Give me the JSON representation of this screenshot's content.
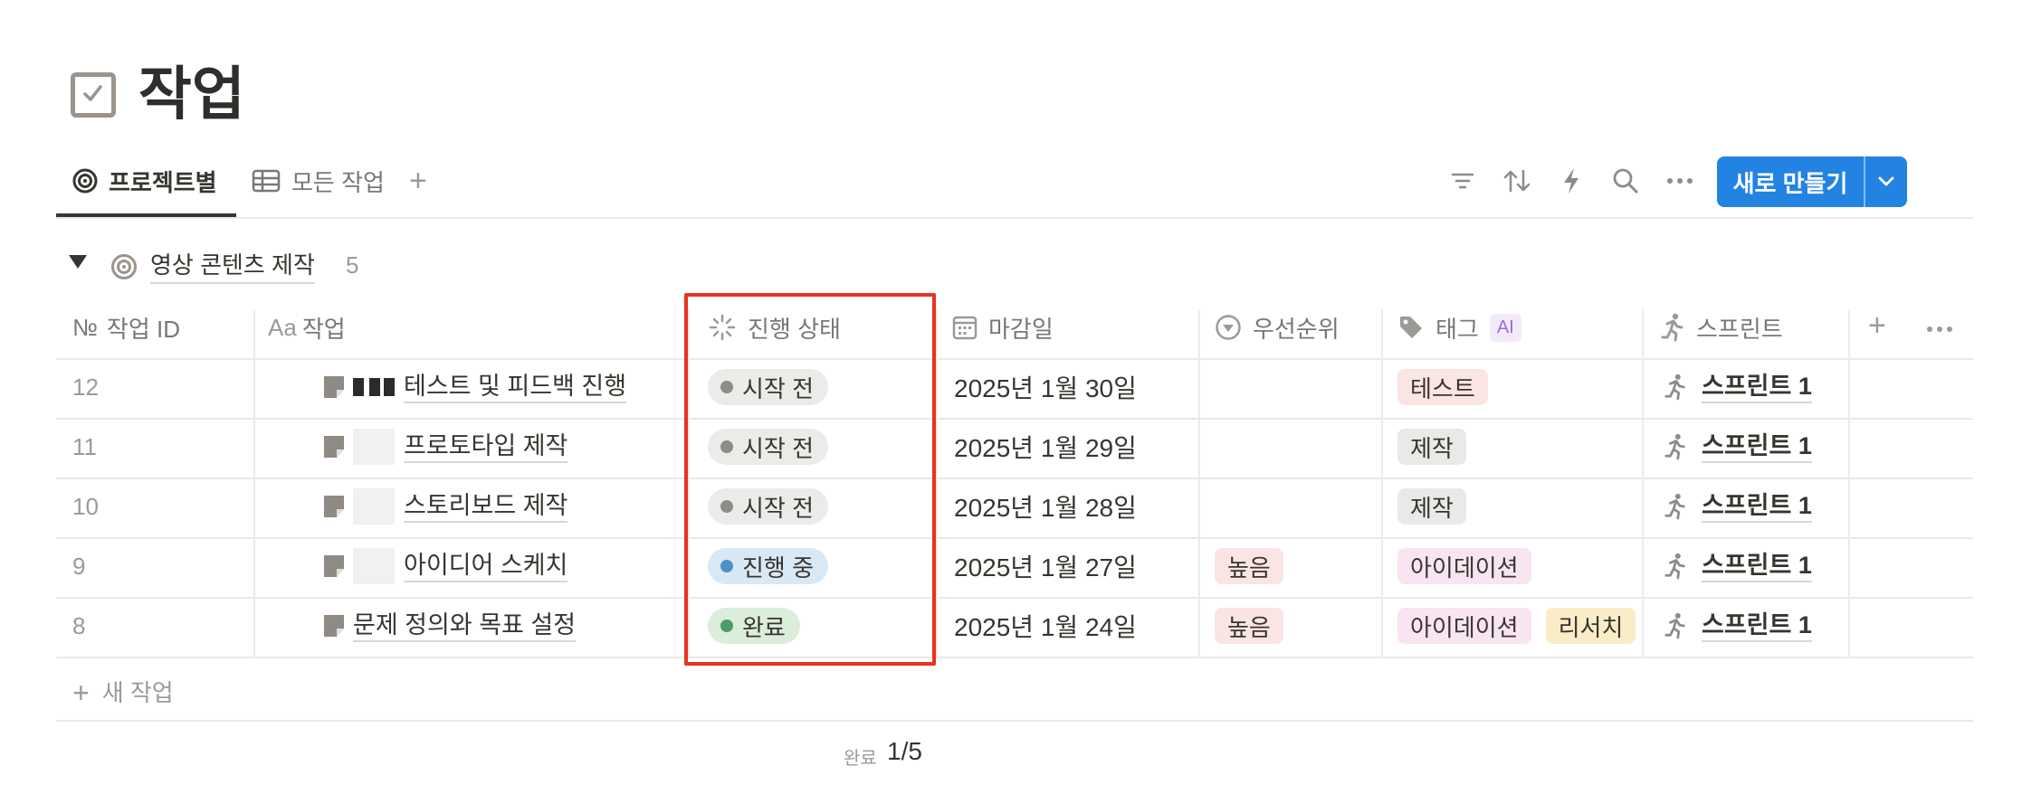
{
  "page": {
    "title": "작업",
    "title_icon": "checkbox-icon"
  },
  "tabs": [
    {
      "label": "프로젝트별",
      "icon": "target-icon",
      "active": true
    },
    {
      "label": "모든 작업",
      "icon": "table-icon",
      "active": false
    }
  ],
  "toolbar": {
    "icons": [
      "filter-icon",
      "sort-icon",
      "automation-icon",
      "search-icon",
      "more-icon"
    ],
    "new_button_label": "새로 만들기"
  },
  "group": {
    "name": "영상 콘텐츠 제작",
    "count": "5"
  },
  "columns": {
    "id": {
      "label": "작업 ID",
      "icon_text": "№"
    },
    "task": {
      "label": "작업",
      "icon_text": "Aa"
    },
    "status": {
      "label": "진행 상태"
    },
    "due": {
      "label": "마감일"
    },
    "priority": {
      "label": "우선순위"
    },
    "tags": {
      "label": "태그",
      "badge": "AI"
    },
    "sprint": {
      "label": "스프린트"
    }
  },
  "rows": [
    {
      "id": "12",
      "task": "테스트 및 피드백 진행",
      "status": "시작 전",
      "status_kind": "not-started",
      "due": "2025년 1월 30일",
      "priority": "",
      "tags": [
        {
          "label": "테스트",
          "color": "#fbe4e4"
        }
      ],
      "sprint": "스프린트 1"
    },
    {
      "id": "11",
      "task": "프로토타입 제작",
      "status": "시작 전",
      "status_kind": "not-started",
      "due": "2025년 1월 29일",
      "priority": "",
      "tags": [
        {
          "label": "제작",
          "color": "#e9e9e7"
        }
      ],
      "sprint": "스프린트 1"
    },
    {
      "id": "10",
      "task": "스토리보드 제작",
      "status": "시작 전",
      "status_kind": "not-started",
      "due": "2025년 1월 28일",
      "priority": "",
      "tags": [
        {
          "label": "제작",
          "color": "#e9e9e7"
        }
      ],
      "sprint": "스프린트 1"
    },
    {
      "id": "9",
      "task": "아이디어 스케치",
      "status": "진행 중",
      "status_kind": "in-progress",
      "due": "2025년 1월 27일",
      "priority": "높음",
      "tags": [
        {
          "label": "아이데이션",
          "color": "#f9e4f1"
        }
      ],
      "sprint": "스프린트 1"
    },
    {
      "id": "8",
      "task": "문제 정의와 목표 설정",
      "status": "완료",
      "status_kind": "done",
      "due": "2025년 1월 24일",
      "priority": "높음",
      "tags": [
        {
          "label": "아이데이션",
          "color": "#f9e4f1"
        },
        {
          "label": "리서치",
          "color": "#fbecc8"
        }
      ],
      "sprint": "스프린트 1"
    }
  ],
  "status_styles": {
    "not-started": {
      "bg": "#ebebea",
      "dot": "#8e8c89"
    },
    "in-progress": {
      "bg": "#d8e8f5",
      "dot": "#4c91c9"
    },
    "done": {
      "bg": "#dbeddb",
      "dot": "#4f9a68"
    }
  },
  "priority_color": "#fbe4e4",
  "new_task_label": "새 작업",
  "summary": {
    "label": "완료",
    "value": "1/5"
  },
  "accent_color": "#2383e2",
  "highlight_color": "#e8321f"
}
